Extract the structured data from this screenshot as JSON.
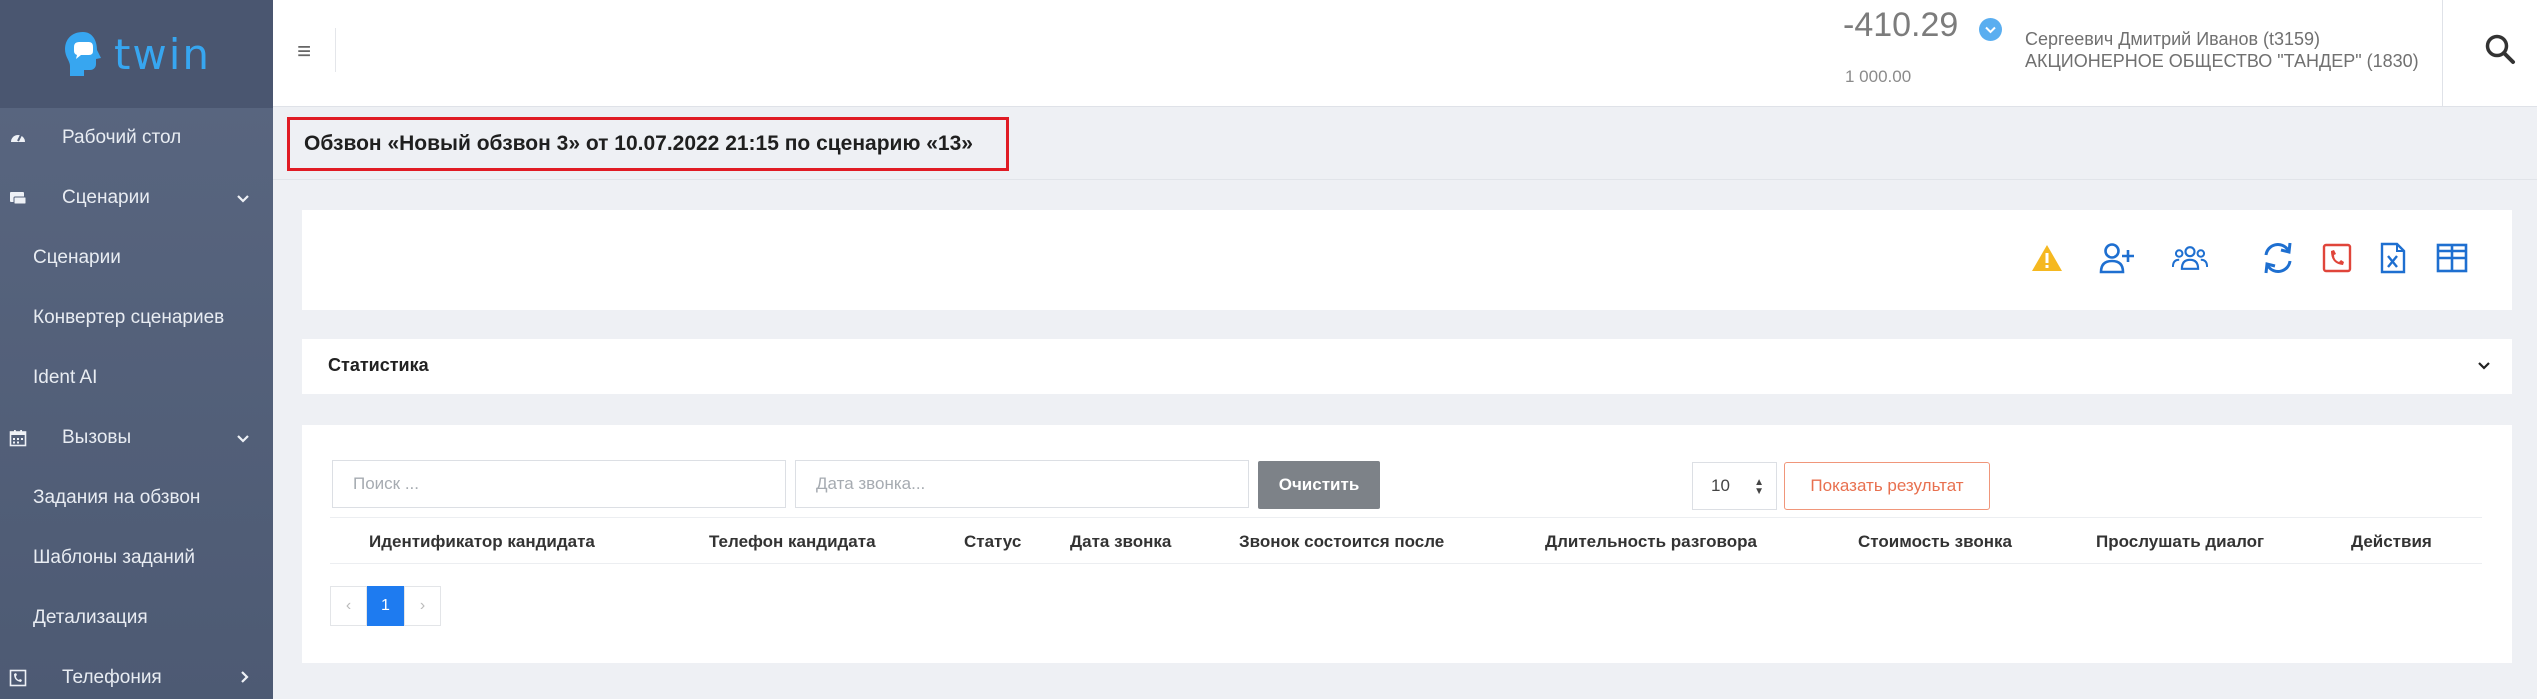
{
  "app": {
    "logo_text": "twin"
  },
  "sidebar": {
    "items": [
      {
        "label": "Рабочий стол",
        "icon": "dashboard-icon",
        "level": "top"
      },
      {
        "label": "Сценарии",
        "icon": "scripts-icon",
        "level": "top",
        "expandable": true
      },
      {
        "label": "Сценарии",
        "level": "sub"
      },
      {
        "label": "Конвертер сценариев",
        "level": "sub"
      },
      {
        "label": "Ident AI",
        "level": "sub"
      },
      {
        "label": "Вызовы",
        "icon": "calendar-icon",
        "level": "top",
        "expandable": true
      },
      {
        "label": "Задания на обзвон",
        "level": "sub"
      },
      {
        "label": "Шаблоны заданий",
        "level": "sub"
      },
      {
        "label": "Детализация",
        "level": "sub"
      },
      {
        "label": "Телефония",
        "icon": "telephony-icon",
        "level": "top",
        "expandable": true
      }
    ]
  },
  "header": {
    "balance": "-410.29",
    "balance_sub": "1 000.00",
    "user_name": "Сергеевич Дмитрий Иванов (t3159)",
    "user_org": "АКЦИОНЕРНОЕ ОБЩЕСТВО \"ТАНДЕР\" (1830)"
  },
  "page": {
    "title": "Обзвон «Новый обзвон 3» от 10.07.2022 21:15 по сценарию «13»"
  },
  "stats": {
    "label": "Статистика"
  },
  "filters": {
    "search_placeholder": "Поиск ...",
    "date_placeholder": "Дата звонка...",
    "clear_label": "Очистить",
    "per_page": "10",
    "show_label": "Показать результат"
  },
  "table": {
    "columns": [
      "Идентификатор кандидата",
      "Телефон кандидата",
      "Статус",
      "Дата звонка",
      "Звонок состоится после",
      "Длительность разговора",
      "Стоимость звонка",
      "Прослушать диалог",
      "Действия"
    ]
  },
  "pagination": {
    "prev": "‹",
    "current": "1",
    "next": "›"
  },
  "colors": {
    "sidebar_bg": "#55627c",
    "accent_blue": "#1e7bf0",
    "warning": "#f5b820",
    "highlight_border": "#e01b24",
    "show_button": "#e8704f"
  }
}
